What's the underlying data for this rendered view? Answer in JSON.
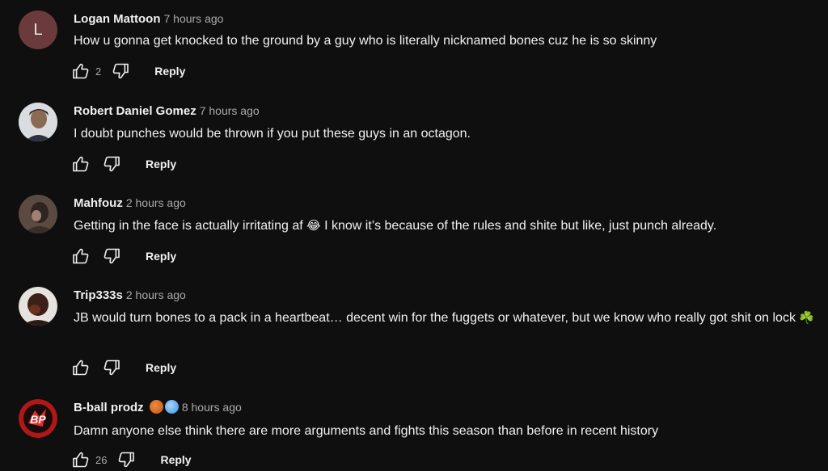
{
  "comments": [
    {
      "author": "Logan Mattoon",
      "time": "7 hours ago",
      "avatar": {
        "letter": "L",
        "color": "#6b3b3b"
      },
      "text": "How u gonna get knocked to the ground by a guy who is literally nicknamed bones cuz he is so skinny",
      "likes": "2",
      "reply": "Reply"
    },
    {
      "author": "Robert Daniel Gomez",
      "time": "7 hours ago",
      "avatar": {
        "letter": ""
      },
      "text": "I doubt punches would be thrown if you put these guys in an octagon.",
      "likes": "",
      "reply": "Reply"
    },
    {
      "author": "Mahfouz",
      "time": "2 hours ago",
      "avatar": {
        "letter": ""
      },
      "text_before_emoji": "Getting in the face is actually irritating af ",
      "emoji": "😂",
      "text_after_emoji": " I know it’s because of the rules and shite but like, just punch already.",
      "likes": "",
      "reply": "Reply"
    },
    {
      "author": "Trip333s",
      "time": "2 hours ago",
      "avatar": {
        "letter": ""
      },
      "text": "JB would turn bones to a pack in a heartbeat… decent win for the fuggets or whatever, but we know who really got shit on lock",
      "emoji": "☘️",
      "likes": "",
      "reply": "Reply"
    },
    {
      "author": "B-ball prodz",
      "time": "8 hours ago",
      "avatar": {
        "letter": ""
      },
      "badges": [
        "basketball-emoji",
        "cold-face-emoji"
      ],
      "text": "Damn anyone else think there are more arguments and fights this season than before in recent history",
      "likes": "26",
      "reply": "Reply"
    }
  ],
  "icons": {
    "like": "thumbs-up-icon",
    "dislike": "thumbs-down-icon"
  },
  "colors": {
    "background": "#0f0f0f",
    "text": "#f1f1f1",
    "secondary": "#aaaaaa"
  }
}
